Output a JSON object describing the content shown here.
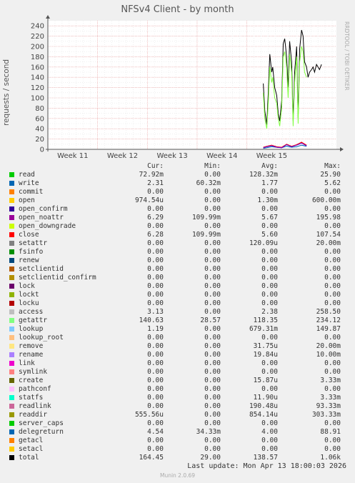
{
  "chart_data": {
    "type": "line",
    "title": "NFSv4 Client - by month",
    "ylabel": "requests / second",
    "side_label": "RRDTOOL / TOBI OETIKER",
    "ylim": [
      0,
      250
    ],
    "yticks": [
      0,
      20,
      40,
      60,
      80,
      100,
      120,
      140,
      160,
      180,
      200,
      220,
      240
    ],
    "xticks": [
      "Week 11",
      "Week 12",
      "Week 13",
      "Week 14",
      "Week 15"
    ],
    "grid": true,
    "series": [
      {
        "name": "total",
        "color": "#000000",
        "x": [
          15.33,
          15.36,
          15.4,
          15.43,
          15.46,
          15.5,
          15.52,
          15.56,
          15.6,
          15.63,
          15.66,
          15.7,
          15.73,
          15.76,
          15.8,
          15.83,
          15.86,
          15.9,
          15.93,
          15.96,
          16.0,
          16.03,
          16.06,
          16.1,
          16.13,
          16.16,
          16.2,
          16.23,
          16.26,
          16.3,
          16.33,
          16.36,
          16.4,
          16.43,
          16.46,
          16.5
        ],
        "values": [
          128,
          75,
          48,
          110,
          185,
          150,
          160,
          120,
          105,
          70,
          55,
          95,
          205,
          215,
          180,
          120,
          210,
          170,
          55,
          150,
          200,
          60,
          195,
          232,
          220,
          170,
          160,
          140,
          150,
          155,
          160,
          150,
          165,
          160,
          155,
          165
        ]
      },
      {
        "name": "getattr",
        "color": "#80ff40",
        "x": [
          15.33,
          15.36,
          15.4,
          15.43,
          15.46,
          15.5,
          15.52,
          15.56,
          15.6,
          15.63,
          15.66,
          15.7,
          15.73,
          15.76,
          15.8,
          15.83,
          15.86,
          15.9,
          15.93,
          15.96,
          16.0,
          16.03,
          16.06,
          16.1,
          16.13,
          16.16,
          16.2
        ],
        "values": [
          110,
          60,
          40,
          90,
          160,
          130,
          140,
          100,
          90,
          60,
          45,
          80,
          180,
          190,
          160,
          100,
          185,
          150,
          45,
          130,
          180,
          50,
          170,
          200,
          190,
          150,
          140
        ]
      },
      {
        "name": "write",
        "color": "#0066b3",
        "x": [
          15.33,
          15.4,
          15.5,
          15.6,
          15.7,
          15.8,
          15.9,
          16.0,
          16.1,
          16.2
        ],
        "values": [
          2,
          3,
          5,
          4,
          3,
          6,
          4,
          5,
          8,
          6
        ]
      },
      {
        "name": "close",
        "color": "#ff0000",
        "x": [
          15.33,
          15.4,
          15.5,
          15.6,
          15.7,
          15.8,
          15.9,
          16.0,
          16.1,
          16.2
        ],
        "values": [
          4,
          6,
          8,
          5,
          4,
          10,
          6,
          9,
          14,
          8
        ]
      },
      {
        "name": "open_noattr",
        "color": "#6600cc",
        "x": [
          15.33,
          15.4,
          15.5,
          15.6,
          15.7,
          15.8,
          15.9,
          16.0,
          16.1,
          16.2
        ],
        "values": [
          3,
          5,
          7,
          4,
          3,
          9,
          5,
          8,
          12,
          7
        ]
      }
    ]
  },
  "legend_headers": {
    "cur": "Cur:",
    "min": "Min:",
    "avg": "Avg:",
    "max": "Max:"
  },
  "legend": [
    {
      "name": "read",
      "color": "#00cc00",
      "cur": "72.92m",
      "min": "0.00",
      "avg": "128.32m",
      "max": "25.90"
    },
    {
      "name": "write",
      "color": "#0066b3",
      "cur": "2.31",
      "min": "60.32m",
      "avg": "1.77",
      "max": "5.62"
    },
    {
      "name": "commit",
      "color": "#ff8000",
      "cur": "0.00",
      "min": "0.00",
      "avg": "0.00",
      "max": "0.00"
    },
    {
      "name": "open",
      "color": "#ffcc00",
      "cur": "974.54u",
      "min": "0.00",
      "avg": "1.30m",
      "max": "600.00m"
    },
    {
      "name": "open_confirm",
      "color": "#330099",
      "cur": "0.00",
      "min": "0.00",
      "avg": "0.00",
      "max": "0.00"
    },
    {
      "name": "open_noattr",
      "color": "#990099",
      "cur": "6.29",
      "min": "109.99m",
      "avg": "5.67",
      "max": "195.98"
    },
    {
      "name": "open_downgrade",
      "color": "#ccff00",
      "cur": "0.00",
      "min": "0.00",
      "avg": "0.00",
      "max": "0.00"
    },
    {
      "name": "close",
      "color": "#ff0000",
      "cur": "6.28",
      "min": "109.99m",
      "avg": "5.60",
      "max": "107.54"
    },
    {
      "name": "setattr",
      "color": "#808080",
      "cur": "0.00",
      "min": "0.00",
      "avg": "120.09u",
      "max": "20.00m"
    },
    {
      "name": "fsinfo",
      "color": "#008f00",
      "cur": "0.00",
      "min": "0.00",
      "avg": "0.00",
      "max": "0.00"
    },
    {
      "name": "renew",
      "color": "#00487d",
      "cur": "0.00",
      "min": "0.00",
      "avg": "0.00",
      "max": "0.00"
    },
    {
      "name": "setclientid",
      "color": "#b35a00",
      "cur": "0.00",
      "min": "0.00",
      "avg": "0.00",
      "max": "0.00"
    },
    {
      "name": "setclientid_confirm",
      "color": "#b38f00",
      "cur": "0.00",
      "min": "0.00",
      "avg": "0.00",
      "max": "0.00"
    },
    {
      "name": "lock",
      "color": "#6b006b",
      "cur": "0.00",
      "min": "0.00",
      "avg": "0.00",
      "max": "0.00"
    },
    {
      "name": "lockt",
      "color": "#8fb300",
      "cur": "0.00",
      "min": "0.00",
      "avg": "0.00",
      "max": "0.00"
    },
    {
      "name": "locku",
      "color": "#b30000",
      "cur": "0.00",
      "min": "0.00",
      "avg": "0.00",
      "max": "0.00"
    },
    {
      "name": "access",
      "color": "#bebebe",
      "cur": "3.13",
      "min": "0.00",
      "avg": "2.38",
      "max": "258.50"
    },
    {
      "name": "getattr",
      "color": "#80ff80",
      "cur": "140.63",
      "min": "28.57",
      "avg": "118.35",
      "max": "234.12"
    },
    {
      "name": "lookup",
      "color": "#80c9ff",
      "cur": "1.19",
      "min": "0.00",
      "avg": "679.31m",
      "max": "149.87"
    },
    {
      "name": "lookup_root",
      "color": "#ffc080",
      "cur": "0.00",
      "min": "0.00",
      "avg": "0.00",
      "max": "0.00"
    },
    {
      "name": "remove",
      "color": "#ffe680",
      "cur": "0.00",
      "min": "0.00",
      "avg": "31.75u",
      "max": "20.00m"
    },
    {
      "name": "rename",
      "color": "#aa80ff",
      "cur": "0.00",
      "min": "0.00",
      "avg": "19.84u",
      "max": "10.00m"
    },
    {
      "name": "link",
      "color": "#ee00cc",
      "cur": "0.00",
      "min": "0.00",
      "avg": "0.00",
      "max": "0.00"
    },
    {
      "name": "symlink",
      "color": "#ff8080",
      "cur": "0.00",
      "min": "0.00",
      "avg": "0.00",
      "max": "0.00"
    },
    {
      "name": "create",
      "color": "#666600",
      "cur": "0.00",
      "min": "0.00",
      "avg": "15.87u",
      "max": "3.33m"
    },
    {
      "name": "pathconf",
      "color": "#ffbfff",
      "cur": "0.00",
      "min": "0.00",
      "avg": "0.00",
      "max": "0.00"
    },
    {
      "name": "statfs",
      "color": "#00ffcc",
      "cur": "0.00",
      "min": "0.00",
      "avg": "11.90u",
      "max": "3.33m"
    },
    {
      "name": "readlink",
      "color": "#cc6699",
      "cur": "0.00",
      "min": "0.00",
      "avg": "190.48u",
      "max": "93.33m"
    },
    {
      "name": "readdir",
      "color": "#999900",
      "cur": "555.56u",
      "min": "0.00",
      "avg": "854.14u",
      "max": "303.33m"
    },
    {
      "name": "server_caps",
      "color": "#00cc00",
      "cur": "0.00",
      "min": "0.00",
      "avg": "0.00",
      "max": "0.00"
    },
    {
      "name": "delegreturn",
      "color": "#0066b3",
      "cur": "4.54",
      "min": "34.33m",
      "avg": "4.00",
      "max": "88.91"
    },
    {
      "name": "getacl",
      "color": "#ff8000",
      "cur": "0.00",
      "min": "0.00",
      "avg": "0.00",
      "max": "0.00"
    },
    {
      "name": "setacl",
      "color": "#ffcc00",
      "cur": "0.00",
      "min": "0.00",
      "avg": "0.00",
      "max": "0.00"
    },
    {
      "name": "total",
      "color": "#000000",
      "cur": "164.45",
      "min": "29.00",
      "avg": "138.57",
      "max": "1.06k"
    }
  ],
  "footer": {
    "last_update": "Last update: Mon Apr 13 18:00:03 2026",
    "version": "Munin 2.0.69"
  }
}
